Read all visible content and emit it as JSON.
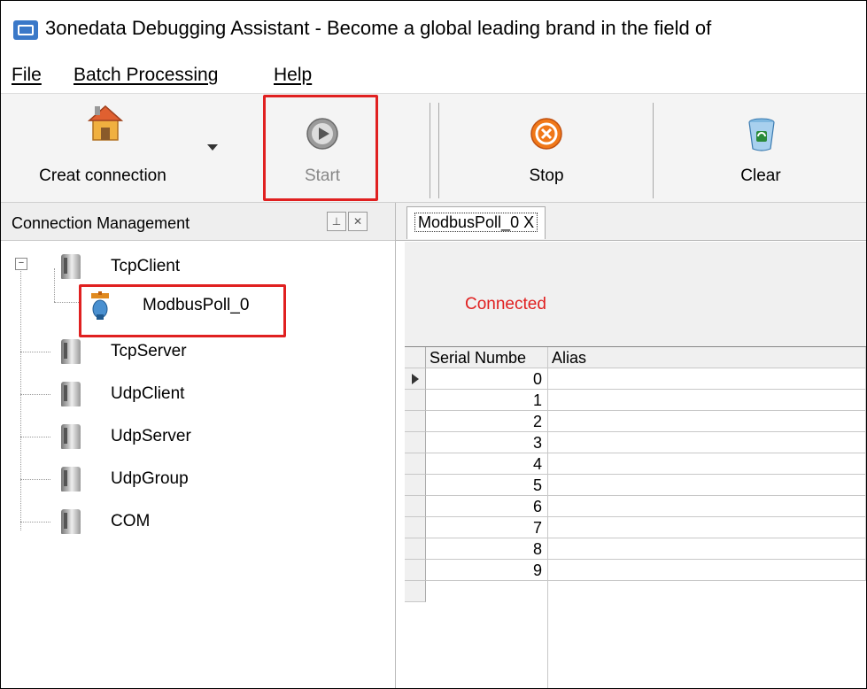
{
  "window": {
    "title": "3onedata Debugging Assistant - Become a global leading brand in the field of"
  },
  "menu": [
    {
      "label": "File"
    },
    {
      "label": "Batch Processing"
    },
    {
      "label": "Help"
    }
  ],
  "toolbar": {
    "create_label": "Creat connection",
    "start_label": "Start",
    "stop_label": "Stop",
    "clear_label": "Clear"
  },
  "connection_panel": {
    "title": "Connection Management",
    "tree": [
      {
        "label": "TcpClient"
      },
      {
        "label": "ModbusPoll_0"
      },
      {
        "label": "TcpServer"
      },
      {
        "label": "UdpClient"
      },
      {
        "label": "UdpServer"
      },
      {
        "label": "UdpGroup"
      },
      {
        "label": "COM"
      }
    ]
  },
  "tab": {
    "label": "ModbusPoll_0",
    "close": "X"
  },
  "status": {
    "text": "Connected"
  },
  "grid": {
    "columns": [
      "Serial Numbe",
      "Alias"
    ],
    "rows": [
      {
        "serial": "0",
        "alias": ""
      },
      {
        "serial": "1",
        "alias": ""
      },
      {
        "serial": "2",
        "alias": ""
      },
      {
        "serial": "3",
        "alias": ""
      },
      {
        "serial": "4",
        "alias": ""
      },
      {
        "serial": "5",
        "alias": ""
      },
      {
        "serial": "6",
        "alias": ""
      },
      {
        "serial": "7",
        "alias": ""
      },
      {
        "serial": "8",
        "alias": ""
      },
      {
        "serial": "9",
        "alias": ""
      }
    ]
  },
  "colors": {
    "highlight": "#e02020",
    "status_connected": "#e02020",
    "start_disabled": "#888888"
  },
  "icons": {
    "create": "house-icon",
    "start": "play-circle-icon",
    "stop": "stop-circle-icon",
    "clear": "recycle-bin-icon",
    "connection_type": "server-icon",
    "connection_item": "connection-plug-icon"
  }
}
